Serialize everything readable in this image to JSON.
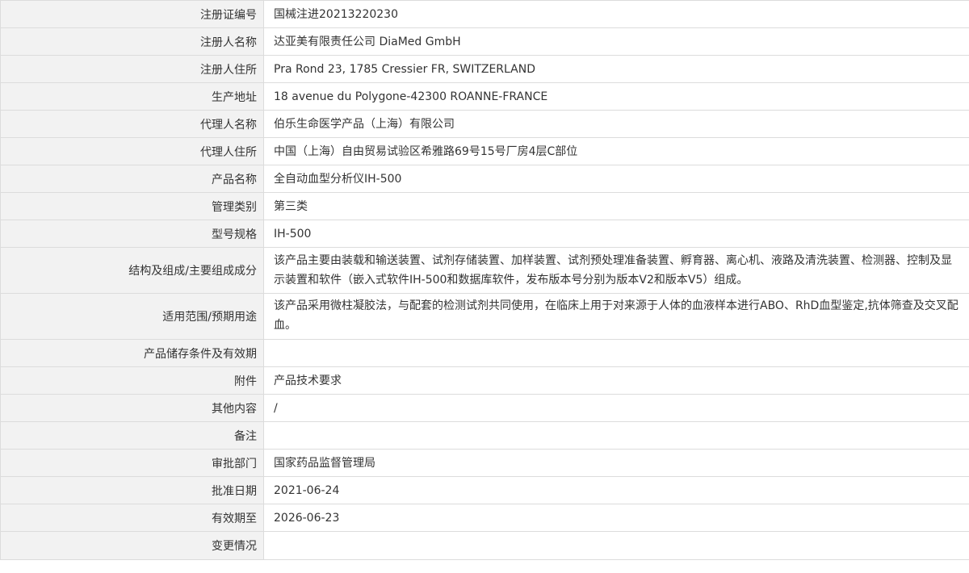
{
  "rows": [
    {
      "label": "注册证编号",
      "value": "国械注进20213220230"
    },
    {
      "label": "注册人名称",
      "value": "达亚美有限责任公司 DiaMed GmbH"
    },
    {
      "label": "注册人住所",
      "value": "Pra Rond 23, 1785 Cressier FR, SWITZERLAND"
    },
    {
      "label": "生产地址",
      "value": "18 avenue du Polygone-42300 ROANNE-FRANCE"
    },
    {
      "label": "代理人名称",
      "value": "伯乐生命医学产品（上海）有限公司"
    },
    {
      "label": "代理人住所",
      "value": "中国（上海）自由贸易试验区希雅路69号15号厂房4层C部位"
    },
    {
      "label": "产品名称",
      "value": "全自动血型分析仪IH-500"
    },
    {
      "label": "管理类别",
      "value": "第三类"
    },
    {
      "label": "型号规格",
      "value": "IH-500"
    },
    {
      "label": "结构及组成/主要组成成分",
      "value": "该产品主要由装载和输送装置、试剂存储装置、加样装置、试剂预处理准备装置、孵育器、离心机、液路及清洗装置、检测器、控制及显示装置和软件（嵌入式软件IH-500和数据库软件，发布版本号分别为版本V2和版本V5）组成。"
    },
    {
      "label": "适用范围/预期用途",
      "value": "该产品采用微柱凝胶法，与配套的检测试剂共同使用，在临床上用于对来源于人体的血液样本进行ABO、RhD血型鉴定,抗体筛查及交叉配血。"
    },
    {
      "label": "产品储存条件及有效期",
      "value": ""
    },
    {
      "label": "附件",
      "value": "产品技术要求"
    },
    {
      "label": "其他内容",
      "value": "/"
    },
    {
      "label": "备注",
      "value": ""
    },
    {
      "label": "审批部门",
      "value": "国家药品监督管理局"
    },
    {
      "label": "批准日期",
      "value": "2021-06-24"
    },
    {
      "label": "有效期至",
      "value": "2026-06-23"
    },
    {
      "label": "变更情况",
      "value": ""
    }
  ]
}
